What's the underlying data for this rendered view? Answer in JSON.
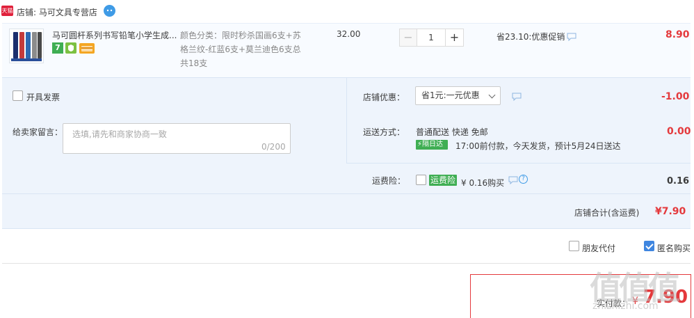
{
  "shop": {
    "badge": "天猫",
    "name": "店铺: 马可文具专营店",
    "wangwang_icon": "wangwang-chat-icon"
  },
  "item": {
    "title": "马可圆杆系列书写铅笔小学生成...",
    "sku": "颜色分类：限时秒杀国画6支+苏格兰纹-红蓝6支+莫兰迪色6支总共18支",
    "unit_price": "32.00",
    "qty_minus": "−",
    "quantity": "1",
    "qty_plus": "+",
    "promo": "省23.10:优惠促销",
    "total": "8.90",
    "badges": [
      "7",
      "shield-icon",
      "card-icon"
    ]
  },
  "options": {
    "invoice_label": "开具发票",
    "shop_discount_label": "店铺优惠：",
    "shop_discount_value": "省1元:一元优惠",
    "shop_discount_amount": "-1.00",
    "message_label": "给卖家留言：",
    "message_placeholder": "选填,请先和商家协商一致",
    "message_count": "0/200",
    "shipping_label": "运送方式：",
    "shipping_method": "普通配送 快递 免邮",
    "shipping_badge": "隔日达",
    "shipping_eta": "17:00前付款，今天发货，预计5月24日送达",
    "shipping_amount": "0.00",
    "insurance_label": "运费险：",
    "insurance_badge": "运费险",
    "insurance_text": "¥ 0.16购买",
    "insurance_amount": "0.16",
    "subtotal_label": "店铺合计(含运费)",
    "subtotal_amount": "¥7.90"
  },
  "footer": {
    "friend_pay_label": "朋友代付",
    "anonymous_label": "匿名购买",
    "pay_label": "实付款：",
    "pay_currency": "¥",
    "pay_amount": "7.90"
  },
  "watermark": {
    "text": "值值值",
    "url": "zhizhizhi.com"
  },
  "colors": {
    "price_red": "#e4393c",
    "accent_green": "#3fae53",
    "accent_blue": "#3f86e0",
    "panel_bg": "#eef4fc"
  }
}
